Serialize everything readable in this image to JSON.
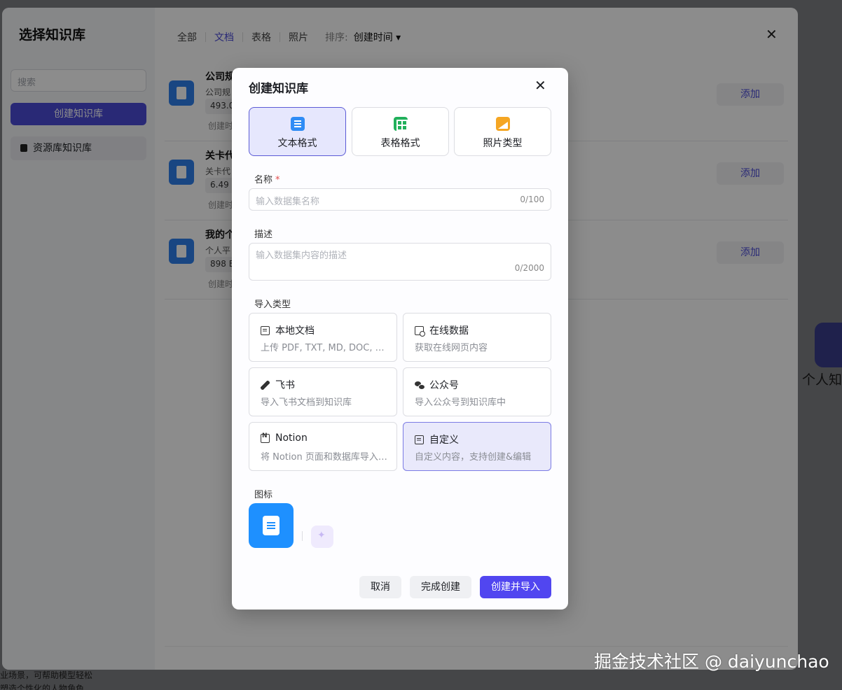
{
  "background": {
    "right_card_text": "个人知",
    "bottom_text_1": "业场景，可帮助模型轻松",
    "bottom_text_2": "塑造个性化的人物角色"
  },
  "outer": {
    "title": "选择知识库",
    "search_placeholder": "搜索",
    "create_button": "创建知识库",
    "resource_item": "资源库知识库",
    "tabs": [
      "全部",
      "文档",
      "表格",
      "照片"
    ],
    "active_tab": "文档",
    "sort_label": "排序:",
    "sort_value": "创建时间 ▾",
    "close": "✕",
    "rows": [
      {
        "name": "公司规",
        "desc": "公司规",
        "size": "493.0",
        "created": "创建时",
        "add": "添加"
      },
      {
        "name": "关卡代",
        "desc": "关卡代",
        "size": "6.49",
        "created": "创建时",
        "add": "添加"
      },
      {
        "name": "我的个",
        "desc": "个人平",
        "size": "898 B",
        "created": "创建时",
        "add": "添加"
      }
    ]
  },
  "modal": {
    "title": "创建知识库",
    "close": "✕",
    "formats": [
      {
        "label": "文本格式",
        "icon": "doc-icon",
        "selected": true
      },
      {
        "label": "表格格式",
        "icon": "sheet-icon",
        "selected": false
      },
      {
        "label": "照片类型",
        "icon": "photo-icon",
        "selected": false
      }
    ],
    "name_label": "名称",
    "name_required": "*",
    "name_placeholder": "输入数据集名称",
    "name_count": "0/100",
    "desc_label": "描述",
    "desc_placeholder": "输入数据集内容的描述",
    "desc_count": "0/2000",
    "import_label": "导入类型",
    "import_types": [
      {
        "title": "本地文档",
        "desc": "上传 PDF, TXT, MD, DOC, DOCX 格式的本地文件",
        "icon": "file-icon"
      },
      {
        "title": "在线数据",
        "desc": "获取在线网页内容",
        "icon": "online-data-icon"
      },
      {
        "title": "飞书",
        "desc": "导入飞书文档到知识库",
        "icon": "feishu-icon"
      },
      {
        "title": "公众号",
        "desc": "导入公众号到知识库中",
        "icon": "wechat-icon"
      },
      {
        "title": "Notion",
        "desc": "将 Notion 页面和数据库导入到知识库",
        "icon": "notion-icon"
      },
      {
        "title": "自定义",
        "desc": "自定义内容，支持创建&编辑",
        "icon": "custom-icon",
        "selected": true
      }
    ],
    "icon_label": "图标",
    "buttons": {
      "cancel": "取消",
      "done": "完成创建",
      "create_import": "创建并导入"
    }
  },
  "watermark": "掘金技术社区 @ daiyunchao",
  "colors": {
    "primary": "#5146f0",
    "selected_bg": "#e6e7fd",
    "required": "#e34d4d"
  }
}
